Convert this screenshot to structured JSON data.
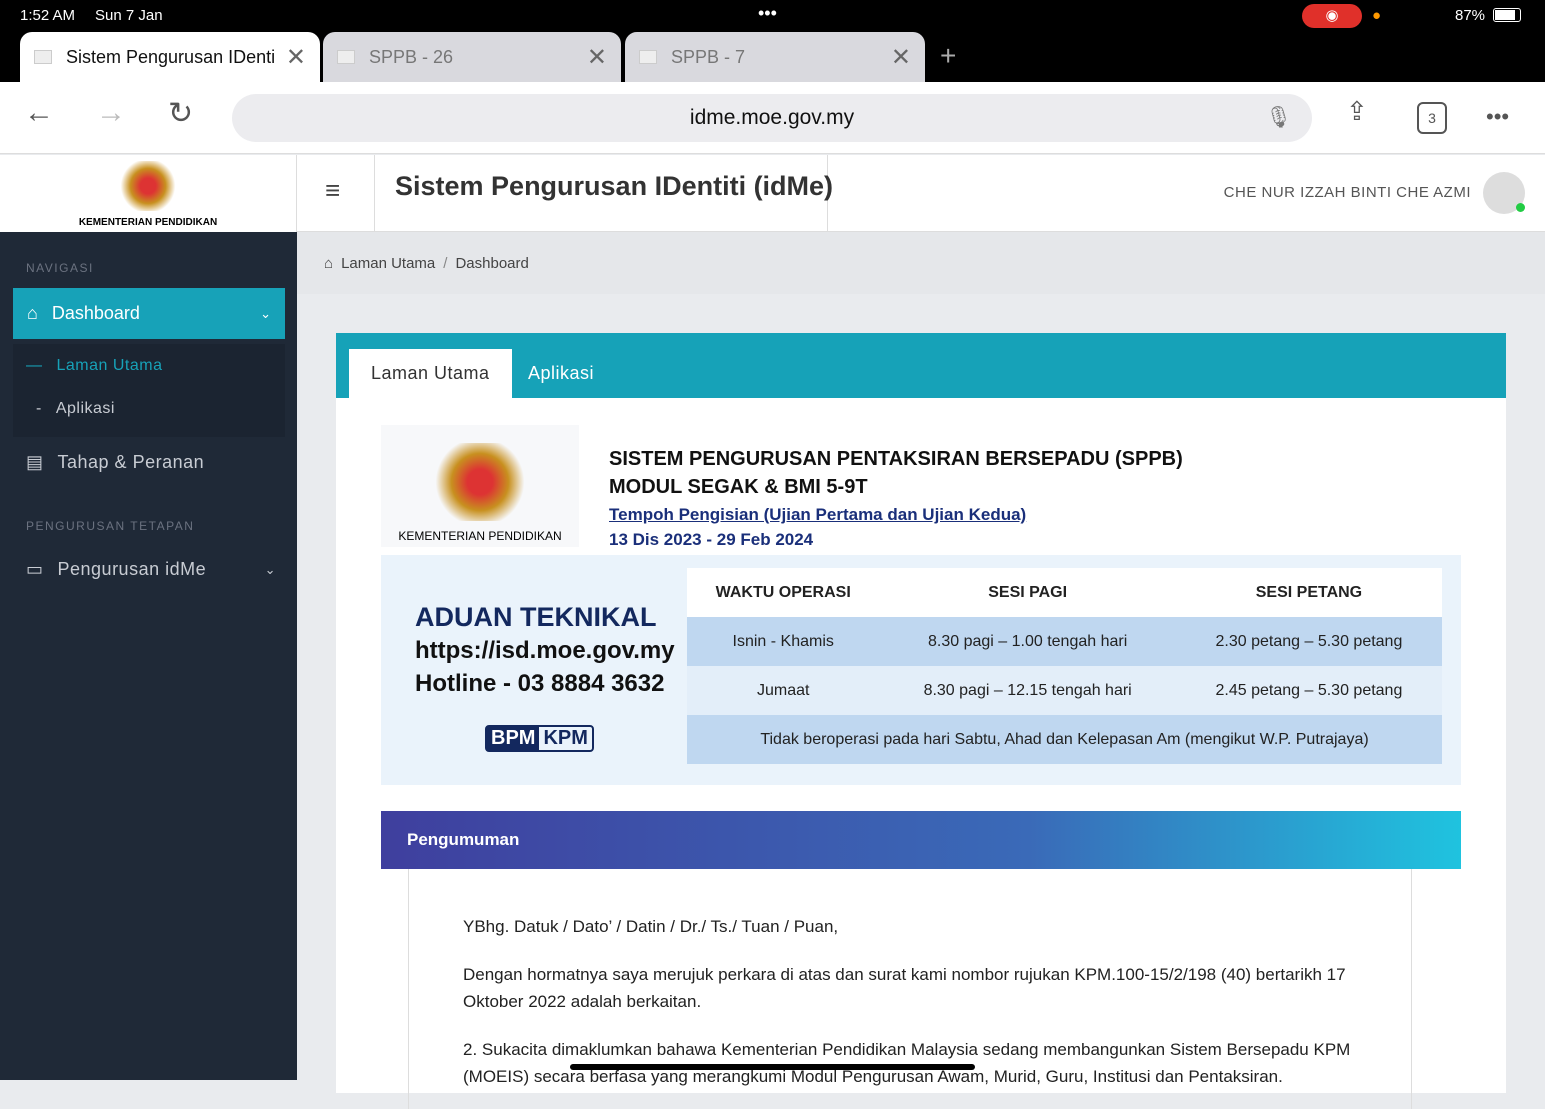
{
  "status": {
    "time": "1:52 AM",
    "date": "Sun 7 Jan",
    "battery": "87%"
  },
  "browser": {
    "tabs": [
      {
        "title": "Sistem Pengurusan IDenti",
        "active": true
      },
      {
        "title": "SPPB - 26",
        "active": false
      },
      {
        "title": "SPPB - 7",
        "active": false
      }
    ],
    "url": "idme.moe.gov.my",
    "tab_count": "3"
  },
  "site": {
    "logo_text": "KEMENTERIAN PENDIDIKAN",
    "title": "Sistem Pengurusan IDentiti (idMe)",
    "user": "CHE NUR IZZAH BINTI CHE AZMI"
  },
  "sidebar": {
    "section1": "NAVIGASI",
    "dashboard": "Dashboard",
    "sub": [
      "Laman Utama",
      "Aplikasi"
    ],
    "tahap": "Tahap & Peranan",
    "section2": "PENGURUSAN TETAPAN",
    "pengurusan": "Pengurusan idMe"
  },
  "breadcrumb": {
    "home": "Laman Utama",
    "current": "Dashboard"
  },
  "tabs": {
    "t1": "Laman Utama",
    "t2": "Aplikasi"
  },
  "banner": {
    "logo_text": "KEMENTERIAN PENDIDIKAN",
    "title1": "SISTEM PENGURUSAN PENTAKSIRAN BERSEPADU (SPPB)",
    "title2": "MODUL SEGAK & BMI 5-9T",
    "period_label": "Tempoh Pengisian (Ujian Pertama dan Ujian Kedua)",
    "period": "13 Dis 2023 - 29 Feb 2024",
    "aduan": "ADUAN TEKNIKAL",
    "aduan_url": "https://isd.moe.gov.my",
    "hotline": "Hotline - 03 8884 3632",
    "bpm": "BPM",
    "kpm": "KPM",
    "table": {
      "headers": [
        "WAKTU OPERASI",
        "SESI PAGI",
        "SESI PETANG"
      ],
      "rows": [
        [
          "Isnin - Khamis",
          "8.30 pagi – 1.00 tengah hari",
          "2.30 petang – 5.30 petang"
        ],
        [
          "Jumaat",
          "8.30 pagi – 12.15 tengah hari",
          "2.45 petang – 5.30 petang"
        ]
      ],
      "note": "Tidak beroperasi pada hari Sabtu, Ahad dan Kelepasan Am (mengikut W.P. Putrajaya)"
    }
  },
  "pengumuman": {
    "title": "Pengumuman",
    "p1": "YBhg. Datuk / Dato’ / Datin / Dr./ Ts./ Tuan / Puan,",
    "p2": "Dengan hormatnya saya merujuk perkara di atas dan surat kami nombor rujukan KPM.100-15/2/198 (40) bertarikh 17 Oktober 2022 adalah berkaitan.",
    "p3": "2. Sukacita dimaklumkan bahawa Kementerian Pendidikan Malaysia sedang membangunkan Sistem Bersepadu KPM (MOEIS) secara berfasa yang merangkumi Modul Pengurusan Awam, Murid, Guru, Institusi dan Pentaksiran."
  }
}
